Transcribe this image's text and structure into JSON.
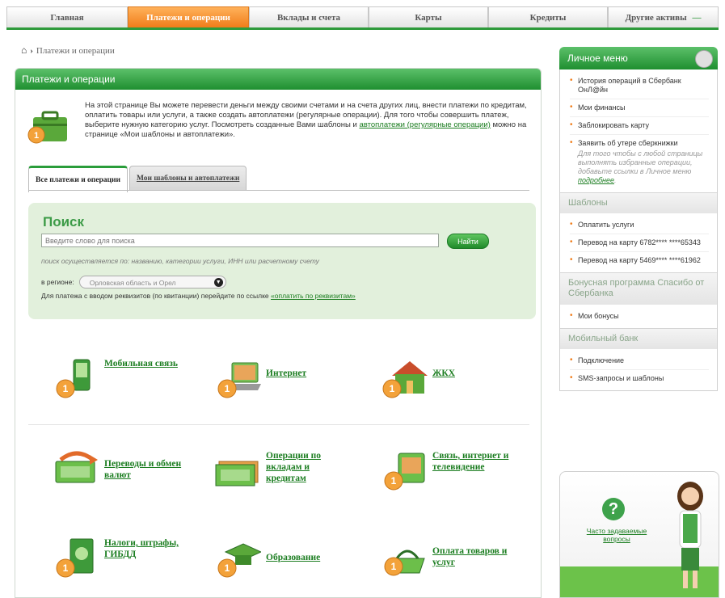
{
  "nav": {
    "tabs": [
      {
        "label": "Главная"
      },
      {
        "label": "Платежи и операции"
      },
      {
        "label": "Вклады и счета"
      },
      {
        "label": "Карты"
      },
      {
        "label": "Кредиты"
      },
      {
        "label": "Другие активы"
      }
    ],
    "more_glyph": "—"
  },
  "breadcrumb": {
    "home_icon": "home-icon",
    "current": "Платежи и операции"
  },
  "panel": {
    "title": "Платежи и операции",
    "intro": {
      "text_1": "На этой странице Вы можете перевести деньги между своими счетами и на счета других лиц, внести платежи по кредитам, оплатить товары или услуги, а также создать автоплатежи (регулярные операции). Для того чтобы совершить платеж, выберите нужную категорию услуг. Посмотреть созданные Вами шаблоны и ",
      "link": "автоплатежи (регулярные операции)",
      "text_2": " можно на странице «Мои шаблоны и автоплатежи»."
    },
    "subtabs": [
      {
        "label": "Все платежи и операции"
      },
      {
        "label": "Мои шаблоны и автоплатежи"
      }
    ],
    "search": {
      "title": "Поиск",
      "placeholder": "Введите слово для поиска",
      "button": "Найти",
      "hint": "поиск осуществляется по: названию, категории услуги, ИНН или расчетному счету",
      "region_label": "в регионе:",
      "region_value": "Орловская область и Орел",
      "requisites_text": "Для платежа с вводом реквизитов (по квитанции) перейдите по ссылке ",
      "requisites_link": "«оплатить по реквизитам»"
    },
    "categories": [
      {
        "label": "Мобильная связь",
        "icon": "mobile-phone-icon"
      },
      {
        "label": "Интернет",
        "icon": "laptop-icon"
      },
      {
        "label": "ЖКХ",
        "icon": "house-icon"
      },
      {
        "label": "Переводы и обмен валют",
        "icon": "money-transfer-icon"
      },
      {
        "label": "Операции по вкладам и кредитам",
        "icon": "banknotes-icon"
      },
      {
        "label": "Связь, интернет и телевидение",
        "icon": "tv-icon"
      },
      {
        "label": "Налоги, штрафы, ГИБДД",
        "icon": "tax-emblem-icon"
      },
      {
        "label": "Образование",
        "icon": "graduation-cap-icon"
      },
      {
        "label": "Оплата товаров и услуг",
        "icon": "shopping-basket-icon"
      }
    ]
  },
  "sidebar": {
    "personal_menu": {
      "title": "Личное меню",
      "items": [
        {
          "label": "История операций в Сбербанк ОнЛ@йн"
        },
        {
          "label": "Мои финансы"
        },
        {
          "label": "Заблокировать карту"
        },
        {
          "label": "Заявить об утере сберкнижки"
        }
      ],
      "note": "Для того чтобы с любой страницы выполнять избранные операции, добавьте ссылки в Личное меню ",
      "note_link": "подробнее"
    },
    "templates": {
      "title": "Шаблоны",
      "items": [
        {
          "label": "Оплатить услуги"
        },
        {
          "label": "Перевод на карту 6782**** ****65343"
        },
        {
          "label": "Перевод на карту 5469**** ****61962"
        }
      ]
    },
    "bonus": {
      "title": "Бонусная программа Спасибо от Сбербанка",
      "items": [
        {
          "label": "Мои бонусы"
        }
      ]
    },
    "mobile_bank": {
      "title": "Мобильный банк",
      "items": [
        {
          "label": "Подключение"
        },
        {
          "label": "SMS-запросы и шаблоны"
        }
      ]
    },
    "faq": {
      "icon": "question-icon",
      "link": "Часто задаваемые вопросы"
    }
  },
  "colors": {
    "brand_green": "#2e9a3b",
    "active_orange": "#f07d1a",
    "search_bg": "#e2f0dc"
  }
}
